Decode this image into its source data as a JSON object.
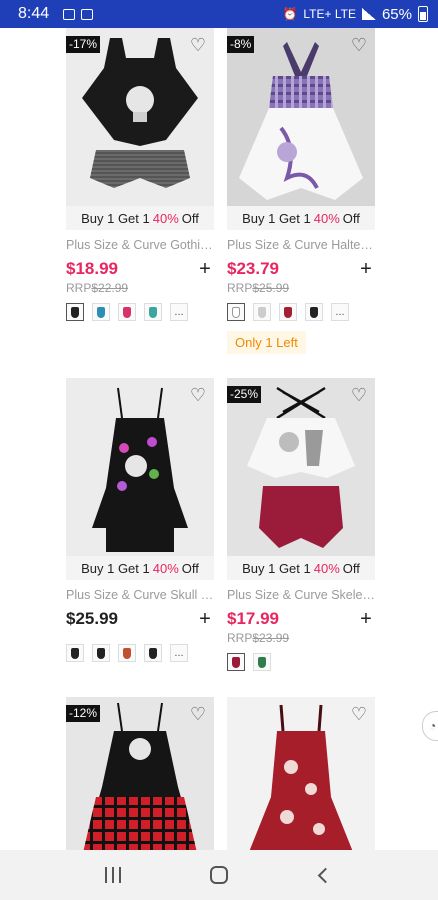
{
  "status_bar": {
    "time": "8:44",
    "network_labels": "LTE+ LTE",
    "battery": "65%"
  },
  "products": [
    {
      "badge": "-17%",
      "promo": {
        "prefix": "Buy 1 Get 1",
        "pct": "40%",
        "suffix": "Off"
      },
      "title": "Plus Size & Curve Gothic Skull Tankini Swimsuit",
      "price": "$18.99",
      "rrp_label": "RRP",
      "rrp": "$22.99",
      "price_style": "sale",
      "swatch_colors": [
        "#222222",
        "#2b8fb5",
        "#d6336c",
        "#3aa6a0"
      ]
    },
    {
      "badge": "-8%",
      "promo": {
        "prefix": "Buy 1 Get 1",
        "pct": "40%",
        "suffix": "Off"
      },
      "title": "Plus Size & Curve Halter Plaid Skull Tankini",
      "price": "$23.79",
      "rrp_label": "RRP",
      "rrp": "$25.99",
      "price_style": "sale",
      "swatch_colors": [
        "#ffffff",
        "#cccccc",
        "#a32033",
        "#222222"
      ],
      "stock_note": "Only 1 Left"
    },
    {
      "badge": "",
      "promo": {
        "prefix": "Buy 1 Get 1",
        "pct": "40%",
        "suffix": "Off"
      },
      "title": "Plus Size & Curve Skull Butterfly Tankini",
      "price": "$25.99",
      "rrp_label": "",
      "rrp": "",
      "price_style": "regular",
      "swatch_colors": [
        "#222222",
        "#222222",
        "#c05030",
        "#222222"
      ]
    },
    {
      "badge": "-25%",
      "promo": {
        "prefix": "Buy 1 Get 1",
        "pct": "40%",
        "suffix": "Off"
      },
      "title": "Plus Size & Curve Skeleton Lattice Tankini",
      "price": "$17.99",
      "rrp_label": "RRP",
      "rrp": "$23.99",
      "price_style": "sale",
      "swatch_colors": [
        "#9b1b3a",
        "#2e7d4f"
      ]
    },
    {
      "badge": "-12%",
      "title": ""
    },
    {
      "badge": "",
      "title": ""
    }
  ],
  "more_label": "...",
  "colors": {
    "accent": "#e8265f",
    "status_bar": "#1f3fb8",
    "stock_note_text": "#f08a00"
  }
}
